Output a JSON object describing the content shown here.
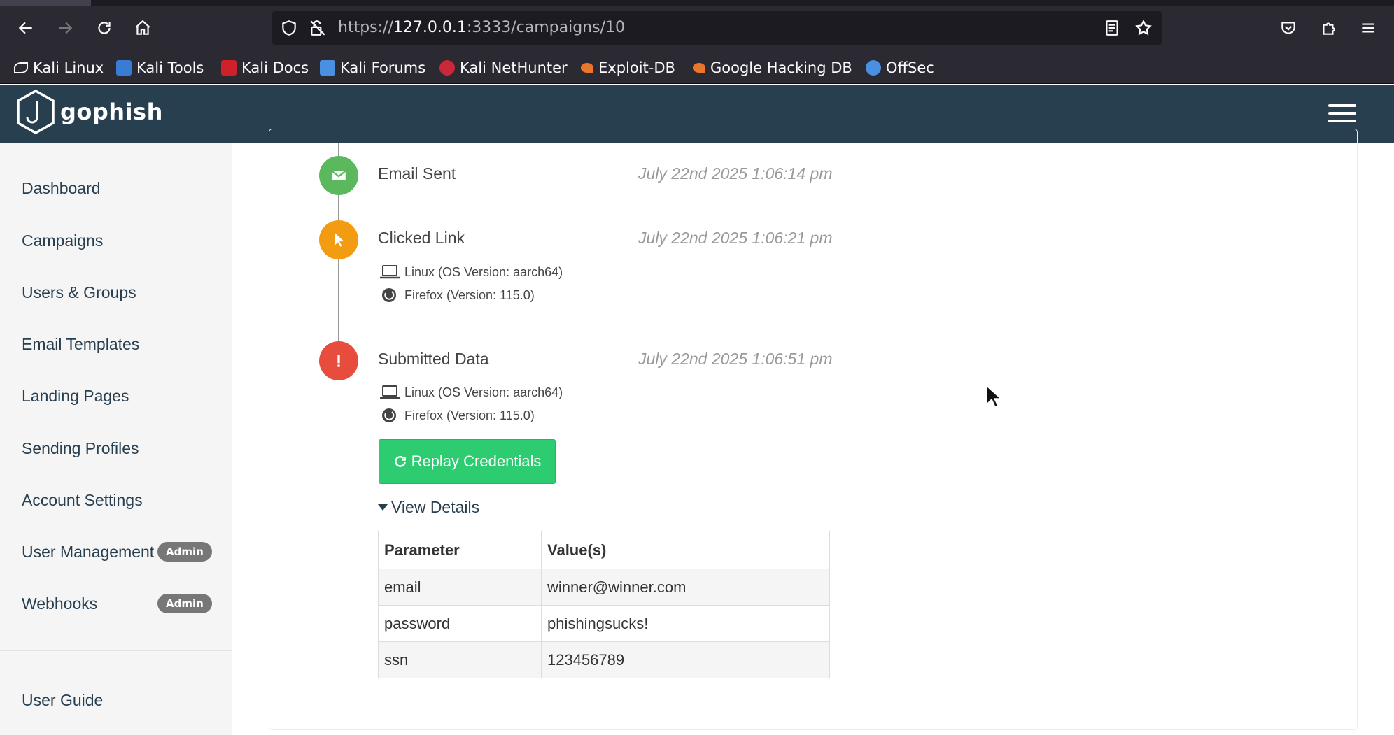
{
  "browser": {
    "url_prefix": "https://",
    "url_host": "127.0.0.1",
    "url_rest": ":3333/campaigns/10",
    "bookmarks": [
      {
        "label": "Kali Linux",
        "color": "#ffffff"
      },
      {
        "label": "Kali Tools",
        "color": "#3a7bd5"
      },
      {
        "label": "Kali Docs",
        "color": "#d0202a"
      },
      {
        "label": "Kali Forums",
        "color": "#4a90e2"
      },
      {
        "label": "Kali NetHunter",
        "color": "#c8283a"
      },
      {
        "label": "Exploit-DB",
        "color": "#e8762d"
      },
      {
        "label": "Google Hacking DB",
        "color": "#e8762d"
      },
      {
        "label": "OffSec",
        "color": "#4a90e2"
      }
    ]
  },
  "app": {
    "brand": "gophish",
    "header_color": "#283f50"
  },
  "sidebar": {
    "items": [
      {
        "label": "Dashboard"
      },
      {
        "label": "Campaigns"
      },
      {
        "label": "Users & Groups"
      },
      {
        "label": "Email Templates"
      },
      {
        "label": "Landing Pages"
      },
      {
        "label": "Sending Profiles"
      },
      {
        "label": "Account Settings"
      },
      {
        "label": "User Management",
        "badge": "Admin"
      },
      {
        "label": "Webhooks",
        "badge": "Admin"
      }
    ],
    "footer_item": "User Guide"
  },
  "timeline": {
    "events": [
      {
        "title": "Email Sent",
        "time": "July 22nd 2025 1:06:14 pm",
        "icon": "envelope-icon",
        "color": "#5cb85c"
      },
      {
        "title": "Clicked Link",
        "time": "July 22nd 2025 1:06:21 pm",
        "icon": "pointer-icon",
        "color": "#f39c12",
        "os": "Linux (OS Version: aarch64)",
        "browser": "Firefox (Version: 115.0)"
      },
      {
        "title": "Submitted Data",
        "time": "July 22nd 2025 1:06:51 pm",
        "icon": "exclamation-icon",
        "color": "#e74c3c",
        "os": "Linux (OS Version: aarch64)",
        "browser": "Firefox (Version: 115.0)"
      }
    ],
    "replay_label": "Replay Credentials",
    "view_details_label": "View Details",
    "table": {
      "headers": [
        "Parameter",
        "Value(s)"
      ],
      "rows": [
        [
          "email",
          "winner@winner.com"
        ],
        [
          "password",
          "phishingsucks!"
        ],
        [
          "ssn",
          "123456789"
        ]
      ]
    }
  }
}
